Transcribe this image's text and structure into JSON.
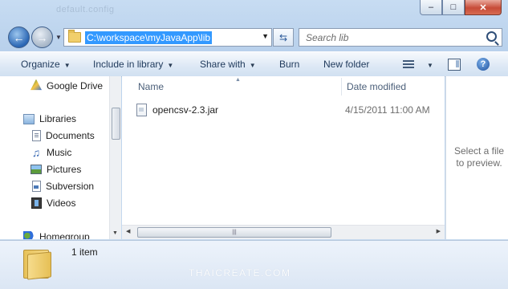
{
  "window": {
    "ghost_title": "default.config",
    "buttons": {
      "minimize": "–",
      "maximize": "□",
      "close": "✕"
    }
  },
  "address": {
    "path": "C:\\workspace\\myJavaApp\\lib",
    "search_placeholder": "Search lib"
  },
  "toolbar": {
    "organize": "Organize",
    "include": "Include in library",
    "share": "Share with",
    "burn": "Burn",
    "new_folder": "New folder",
    "help": "?"
  },
  "nav": {
    "items": [
      {
        "label": "Google Drive",
        "icon": "google-drive-icon"
      },
      {
        "label": "Libraries",
        "icon": "libraries-icon"
      },
      {
        "label": "Documents",
        "icon": "documents-icon"
      },
      {
        "label": "Music",
        "icon": "music-icon"
      },
      {
        "label": "Pictures",
        "icon": "pictures-icon"
      },
      {
        "label": "Subversion",
        "icon": "subversion-icon"
      },
      {
        "label": "Videos",
        "icon": "videos-icon"
      },
      {
        "label": "Homegroup",
        "icon": "homegroup-icon"
      }
    ]
  },
  "files": {
    "columns": {
      "name": "Name",
      "date": "Date modified"
    },
    "rows": [
      {
        "name": "opencsv-2.3.jar",
        "date": "4/15/2011 11:00 AM"
      }
    ]
  },
  "preview": {
    "text": "Select a file to preview."
  },
  "details": {
    "count": "1 item",
    "watermark": "THAICREATE.COM"
  }
}
